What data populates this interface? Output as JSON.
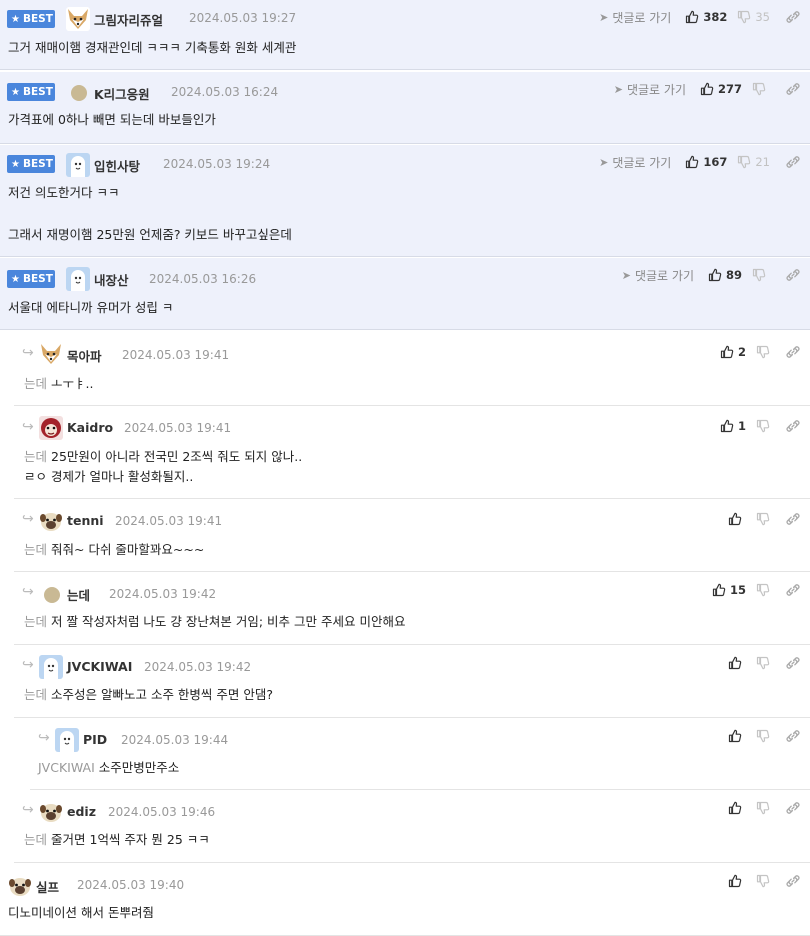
{
  "ui": {
    "best_label": "BEST",
    "goto_label": "댓글로 가기"
  },
  "best_comments": [
    {
      "nick": "그림자리쥬얼",
      "date": "2024.05.03 19:27",
      "lines": [
        "그거 재매이햄 경재관인데 ㅋㅋㅋ 기축통화 원화 세계관"
      ],
      "up": "382",
      "down": "35"
    },
    {
      "nick": "K리그응원",
      "date": "2024.05.03 16:24",
      "lines": [
        "가격표에 0하나 빼면 되는데 바보들인가"
      ],
      "up": "277",
      "down": ""
    },
    {
      "nick": "입힌사탕",
      "date": "2024.05.03 19:24",
      "lines": [
        "저건 의도한거다 ㅋㅋ",
        "",
        "그래서 재명이햄 25만원 언제줌? 키보드 바꾸고싶은데"
      ],
      "up": "167",
      "down": "21"
    },
    {
      "nick": "내장산",
      "date": "2024.05.03 16:26",
      "lines": [
        "서울대 에타니까 유머가 성립 ㅋ"
      ],
      "up": "89",
      "down": ""
    }
  ],
  "replies": [
    {
      "nick": "목아파",
      "date": "2024.05.03 19:41",
      "prefix": "는데",
      "lines": [
        "ㅗㅜㅑ.."
      ],
      "up": "2"
    },
    {
      "nick": "Kaidro",
      "date": "2024.05.03 19:41",
      "prefix": "는데",
      "lines": [
        "25만원이 아니라 전국민 2조씩 줘도 되지 않나..",
        "ㄹㅇ 경제가 얼마나 활성화될지.."
      ],
      "up": "1"
    },
    {
      "nick": "tenni",
      "date": "2024.05.03 19:41",
      "prefix": "는데",
      "lines": [
        "줘줘~ 다쉬 줄마할꽈요~~~"
      ],
      "up": ""
    },
    {
      "nick": "는데",
      "date": "2024.05.03 19:42",
      "prefix": "는데",
      "lines": [
        "저 짤 작성자처럼 나도 걍 장난쳐본 거임; 비추 그만 주세요 미안해요"
      ],
      "up": "15"
    },
    {
      "nick": "JVCKIWAI",
      "date": "2024.05.03 19:42",
      "prefix": "는데",
      "lines": [
        "소주성은 알빠노고 소주 한병씩 주면 안댐?"
      ],
      "up": ""
    },
    {
      "nick": "PID",
      "date": "2024.05.03 19:44",
      "prefix": "JVCKIWAI",
      "lines": [
        "소주만병만주소"
      ],
      "up": ""
    },
    {
      "nick": "ediz",
      "date": "2024.05.03 19:46",
      "prefix": "는데",
      "lines": [
        "줄거면 1억씩 주자 뭔 25 ㅋㅋ"
      ],
      "up": ""
    },
    {
      "nick": "실프",
      "date": "2024.05.03 19:40",
      "prefix": "",
      "lines": [
        "디노미네이션 해서 돈뿌려줨"
      ],
      "up": ""
    }
  ]
}
